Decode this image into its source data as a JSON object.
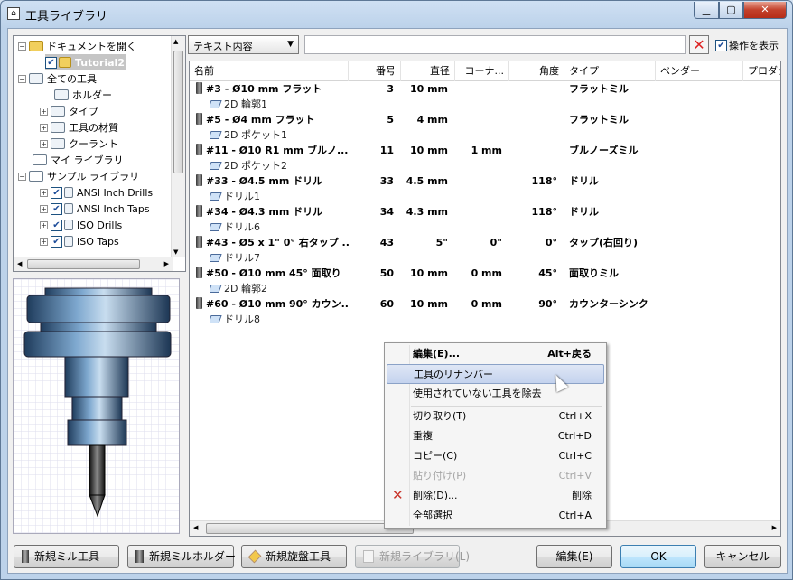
{
  "window": {
    "title": "工具ライブラリ",
    "icon": "library-icon"
  },
  "tree": {
    "nodes": [
      {
        "label": "ドキュメントを開く",
        "expander": "−",
        "icon": "folder-open-icon"
      },
      {
        "label": "Tutorial2",
        "checked": true,
        "icon": "document-icon"
      },
      {
        "label": "全ての工具",
        "expander": "−",
        "icon": "all-tools-icon"
      },
      {
        "label": "ホルダー",
        "icon": "holder-icon"
      },
      {
        "label": "タイプ",
        "expander": "+",
        "icon": "type-icon"
      },
      {
        "label": "工具の材質",
        "expander": "+",
        "icon": "material-icon"
      },
      {
        "label": "クーラント",
        "expander": "+",
        "icon": "coolant-icon"
      },
      {
        "label": "マイ ライブラリ",
        "icon": "folder-icon"
      },
      {
        "label": "サンプル ライブラリ",
        "expander": "−",
        "icon": "folder-icon"
      },
      {
        "label": "ANSI Inch Drills",
        "expander": "+",
        "checked": true
      },
      {
        "label": "ANSI Inch Taps",
        "expander": "+",
        "checked": true
      },
      {
        "label": "ISO Drills",
        "expander": "+",
        "checked": true
      },
      {
        "label": "ISO Taps",
        "expander": "+",
        "checked": true
      }
    ]
  },
  "filter": {
    "field": "テキスト内容",
    "value": "",
    "show_ops_label": "操作を表示",
    "show_ops_checked": true
  },
  "columns": [
    "名前",
    "番号",
    "直径",
    "コーナ...",
    "角度",
    "タイプ",
    "ベンダー",
    "プロダク"
  ],
  "tools": [
    {
      "name": "#3 - Ø10 mm フラット",
      "num": "3",
      "dia": "10 mm",
      "corner": "",
      "angle": "",
      "type": "フラットミル",
      "op": "2D 輪郭1"
    },
    {
      "name": "#5 - Ø4 mm フラット",
      "num": "5",
      "dia": "4 mm",
      "corner": "",
      "angle": "",
      "type": "フラットミル",
      "op": "2D ポケット1"
    },
    {
      "name": "#11 - Ø10 R1 mm ブルノ...",
      "num": "11",
      "dia": "10 mm",
      "corner": "1 mm",
      "angle": "",
      "type": "ブルノーズミル",
      "op": "2D ポケット2"
    },
    {
      "name": "#33 - Ø4.5 mm ドリル",
      "num": "33",
      "dia": "4.5 mm",
      "corner": "",
      "angle": "118°",
      "type": "ドリル",
      "op": "ドリル1"
    },
    {
      "name": "#34 - Ø4.3 mm ドリル",
      "num": "34",
      "dia": "4.3 mm",
      "corner": "",
      "angle": "118°",
      "type": "ドリル",
      "op": "ドリル6"
    },
    {
      "name": "#43 - Ø5 x 1\" 0° 右タップ ...",
      "num": "43",
      "dia": "5\"",
      "corner": "0\"",
      "angle": "0°",
      "type": "タップ(右回り)",
      "op": "ドリル7"
    },
    {
      "name": "#50 - Ø10 mm 45° 面取り",
      "num": "50",
      "dia": "10 mm",
      "corner": "0 mm",
      "angle": "45°",
      "type": "面取りミル",
      "op": "2D 輪郭2"
    },
    {
      "name": "#60 - Ø10 mm 90° カウン...",
      "num": "60",
      "dia": "10 mm",
      "corner": "0 mm",
      "angle": "90°",
      "type": "カウンターシンク",
      "op": "ドリル8"
    }
  ],
  "context_menu": [
    {
      "label": "編集(E)...",
      "shortcut": "Alt+戻る",
      "bold": true
    },
    {
      "label": "工具のリナンバー",
      "shortcut": "",
      "selected": true
    },
    {
      "label": "使用されていない工具を除去",
      "shortcut": ""
    },
    {
      "label": "切り取り(T)",
      "shortcut": "Ctrl+X"
    },
    {
      "label": "重複",
      "shortcut": "Ctrl+D"
    },
    {
      "label": "コピー(C)",
      "shortcut": "Ctrl+C"
    },
    {
      "label": "貼り付け(P)",
      "shortcut": "Ctrl+V",
      "disabled": true
    },
    {
      "label": "削除(D)...",
      "shortcut": "削除",
      "icon": "delete-icon"
    },
    {
      "label": "全部選択",
      "shortcut": "Ctrl+A"
    }
  ],
  "buttons": {
    "new_mill": "新規ミル工具",
    "new_holder": "新規ミルホルダー",
    "new_lathe": "新規旋盤工具",
    "new_library": "新規ライブラリ(L)",
    "edit": "編集(E)",
    "ok": "OK",
    "cancel": "キャンセル"
  }
}
